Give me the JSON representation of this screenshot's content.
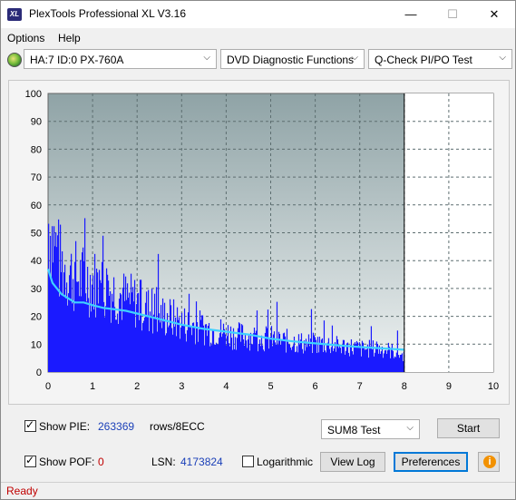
{
  "window": {
    "title": "PlexTools Professional XL V3.16",
    "app_icon_text": "XL"
  },
  "menu": {
    "options": "Options",
    "help": "Help"
  },
  "toolbar": {
    "drive": "HA:7 ID:0  PX-760A",
    "function": "DVD Diagnostic Functions",
    "test": "Q-Check PI/PO Test"
  },
  "chart_data": {
    "type": "bar",
    "title": "",
    "xlabel": "",
    "ylabel": "",
    "xlim": [
      0,
      10
    ],
    "ylim": [
      0,
      100
    ],
    "x_ticks": [
      0,
      1,
      2,
      3,
      4,
      5,
      6,
      7,
      8,
      9,
      10
    ],
    "y_ticks": [
      0,
      10,
      20,
      30,
      40,
      50,
      60,
      70,
      80,
      90,
      100
    ],
    "grid": true,
    "data_end_x": 8,
    "series": [
      {
        "color": "#1a1aff",
        "type": "bar",
        "x": [
          0.0,
          0.25,
          0.5,
          0.75,
          1.0,
          1.25,
          1.5,
          1.75,
          2.0,
          2.25,
          2.5,
          2.75,
          3.0,
          3.25,
          3.5,
          3.75,
          4.0,
          4.25,
          4.5,
          4.75,
          5.0,
          5.25,
          5.5,
          5.75,
          6.0,
          6.25,
          6.5,
          6.75,
          7.0,
          7.25,
          7.5,
          7.75,
          8.0
        ],
        "values": [
          58,
          42,
          38,
          36,
          35,
          33,
          31,
          28,
          27,
          24,
          22,
          21,
          19,
          18,
          17,
          16,
          15,
          14,
          14,
          13,
          13,
          12,
          12,
          11,
          11,
          11,
          10,
          10,
          9,
          9,
          9,
          8,
          6
        ]
      },
      {
        "color": "#3fd1ff",
        "type": "line",
        "x": [
          0.0,
          0.1,
          0.2,
          0.3,
          0.4,
          0.5,
          0.6,
          0.8,
          1.0,
          1.25,
          1.5,
          1.75,
          2.0,
          2.25,
          2.5,
          2.75,
          3.0,
          3.5,
          4.0,
          4.5,
          5.0,
          5.5,
          6.0,
          6.5,
          7.0,
          7.5,
          8.0
        ],
        "values": [
          37,
          32,
          30,
          28,
          27,
          26,
          25,
          25,
          24,
          23,
          22.5,
          22,
          21,
          20,
          19,
          18,
          17,
          15.5,
          14.5,
          13.5,
          12,
          11,
          10.3,
          9.6,
          9,
          8.5,
          8
        ]
      }
    ]
  },
  "stats": {
    "show_pie_label": "Show PIE:",
    "pie_value": "263369",
    "pie_unit": "rows/8ECC",
    "show_pof_label": "Show POF:",
    "pof_value": "0",
    "lsn_label": "LSN:",
    "lsn_value": "4173824",
    "logarithmic_label": "Logarithmic"
  },
  "controls": {
    "test_mode": "SUM8 Test",
    "start": "Start",
    "view_log": "View Log",
    "preferences": "Preferences"
  },
  "status": {
    "text": "Ready"
  }
}
